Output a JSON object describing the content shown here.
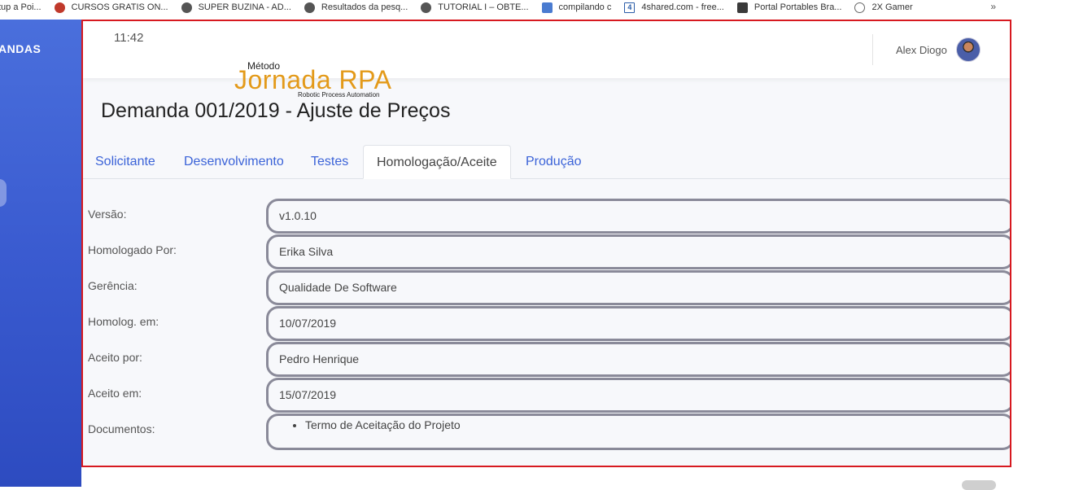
{
  "bookmarks": [
    {
      "label": "tup a Poi...",
      "icon": "none"
    },
    {
      "label": "CURSOS GRATIS ON...",
      "icon": "red-circle-icon"
    },
    {
      "label": "SUPER BUZINA - AD...",
      "icon": "globe-icon"
    },
    {
      "label": "Resultados da pesq...",
      "icon": "globe-icon"
    },
    {
      "label": "TUTORIAL I – OBTE...",
      "icon": "globe-icon"
    },
    {
      "label": "compilando c",
      "icon": "translate-icon"
    },
    {
      "label": "4shared.com - free...",
      "icon": "4shared-icon"
    },
    {
      "label": "Portal Portables Bra...",
      "icon": "portal-icon"
    },
    {
      "label": "2X Gamer",
      "icon": "wordpress-icon"
    }
  ],
  "bookmarks_more": "»",
  "sidebar": {
    "title": "ANDAS"
  },
  "header": {
    "time": "11:42",
    "user_name": "Alex Diogo"
  },
  "logo": {
    "small": "Método",
    "big": "Jornada RPA",
    "sub": "Robotic Process Automation"
  },
  "page": {
    "title": "Demanda 001/2019 - Ajuste de Preços"
  },
  "tabs": [
    {
      "label": "Solicitante",
      "active": false
    },
    {
      "label": "Desenvolvimento",
      "active": false
    },
    {
      "label": "Testes",
      "active": false
    },
    {
      "label": "Homologação/Aceite",
      "active": true
    },
    {
      "label": "Produção",
      "active": false
    }
  ],
  "form": {
    "rows": [
      {
        "label": "Versão:",
        "value": "v1.0.10"
      },
      {
        "label": "Homologado Por:",
        "value": "Erika Silva"
      },
      {
        "label": "Gerência:",
        "value": "Qualidade De Software"
      },
      {
        "label": "Homolog. em:",
        "value": "10/07/2019"
      },
      {
        "label": "Aceito por:",
        "value": "Pedro Henrique"
      },
      {
        "label": "Aceito em:",
        "value": "15/07/2019"
      }
    ],
    "documents_label": "Documentos:",
    "documents": [
      "Termo de Aceitação do Projeto"
    ]
  },
  "colors": {
    "accent": "#3b63d8",
    "frame_border": "#d71920",
    "logo": "#e39a1a",
    "sidebar": "#3a5bd0"
  }
}
